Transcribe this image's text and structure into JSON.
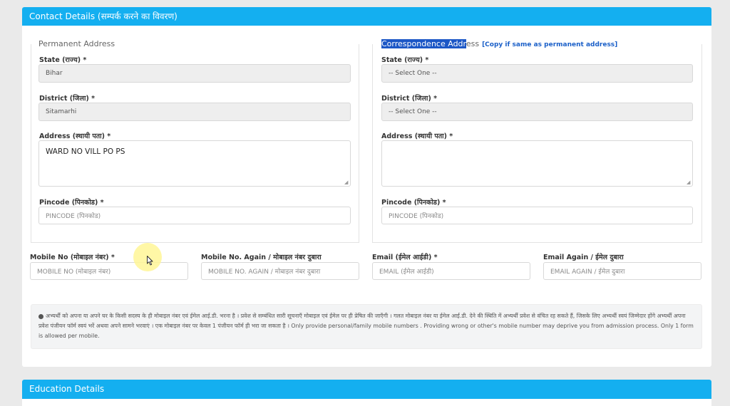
{
  "contact_section": {
    "title": "Contact Details (सम्पर्क करने का विवरण)"
  },
  "permanent": {
    "legend": "Permanent Address",
    "state_label": "State (राज्य) *",
    "state_value": "Bihar",
    "district_label": "District (जिला) *",
    "district_value": "Sitamarhi",
    "address_label": "Address (स्थायी पता) *",
    "address_value": "WARD NO VILL PO PS",
    "pincode_label": "Pincode (पिनकोड) *",
    "pincode_placeholder": "PINCODE (पिनकोड)"
  },
  "correspondence": {
    "legend_highlight": "Correspondence Addr",
    "legend_rest": "ess",
    "copy_link": "[Copy if same as permanent address]",
    "state_label": "State (राज्य) *",
    "state_value": "-- Select One --",
    "district_label": "District (जिला) *",
    "district_value": "-- Select One --",
    "address_label": "Address (स्थायी पता) *",
    "address_value": "",
    "pincode_label": "Pincode (पिनकोड) *",
    "pincode_placeholder": "PINCODE (पिनकोड)"
  },
  "contact": {
    "mobile_label": "Mobile No (मोबाइल नंबर) *",
    "mobile_placeholder": "MOBILE NO (मोबाइल नंबर)",
    "mobile_again_label": "Mobile No. Again / मोबाइल नंबर दुबारा",
    "mobile_again_placeholder": "MOBILE NO. AGAIN / मोबाइल नंबर दुबारा",
    "email_label": "Email (ईमेल आईडी) *",
    "email_placeholder": "EMAIL (ईमेल आईडी)",
    "email_again_label": "Email Again / ईमेल दुबारा",
    "email_again_placeholder": "EMAIL AGAIN / ईमेल दुबारा"
  },
  "notice": {
    "text": "अभ्यर्थी को अपना या अपने घर के किसी सदस्य के ही मोबाइल नंबर एवं ईमेल आई.डी. भरना है । प्रवेश से सम्बंधित सारी सूचनाएँ मोबाइल एवं ईमेल पर ही प्रेषित की जाएँगी । गलत मोबाइल नंबर या ईमेल आई.डी. देने की स्थिति में अभ्यर्थी प्रवेश से वंचित रह सकते हैं, जिसके लिए अभ्यर्थी स्वयं जिम्मेदार होंगे अभ्यर्थी अपना प्रवेश पंजीयन फॉर्म स्वयं भरें अथवा अपने सामने भरवाएं । एक मोबाइल नंबर पर केवल 1 पंजीयन फॉर्म ही भरा जा सकता है । Only provide personal/family mobile numbers . Providing wrong or other's mobile number may deprive you from admission process. Only 1 form is allowed per mobile."
  },
  "education_section": {
    "title": "Education Details"
  }
}
